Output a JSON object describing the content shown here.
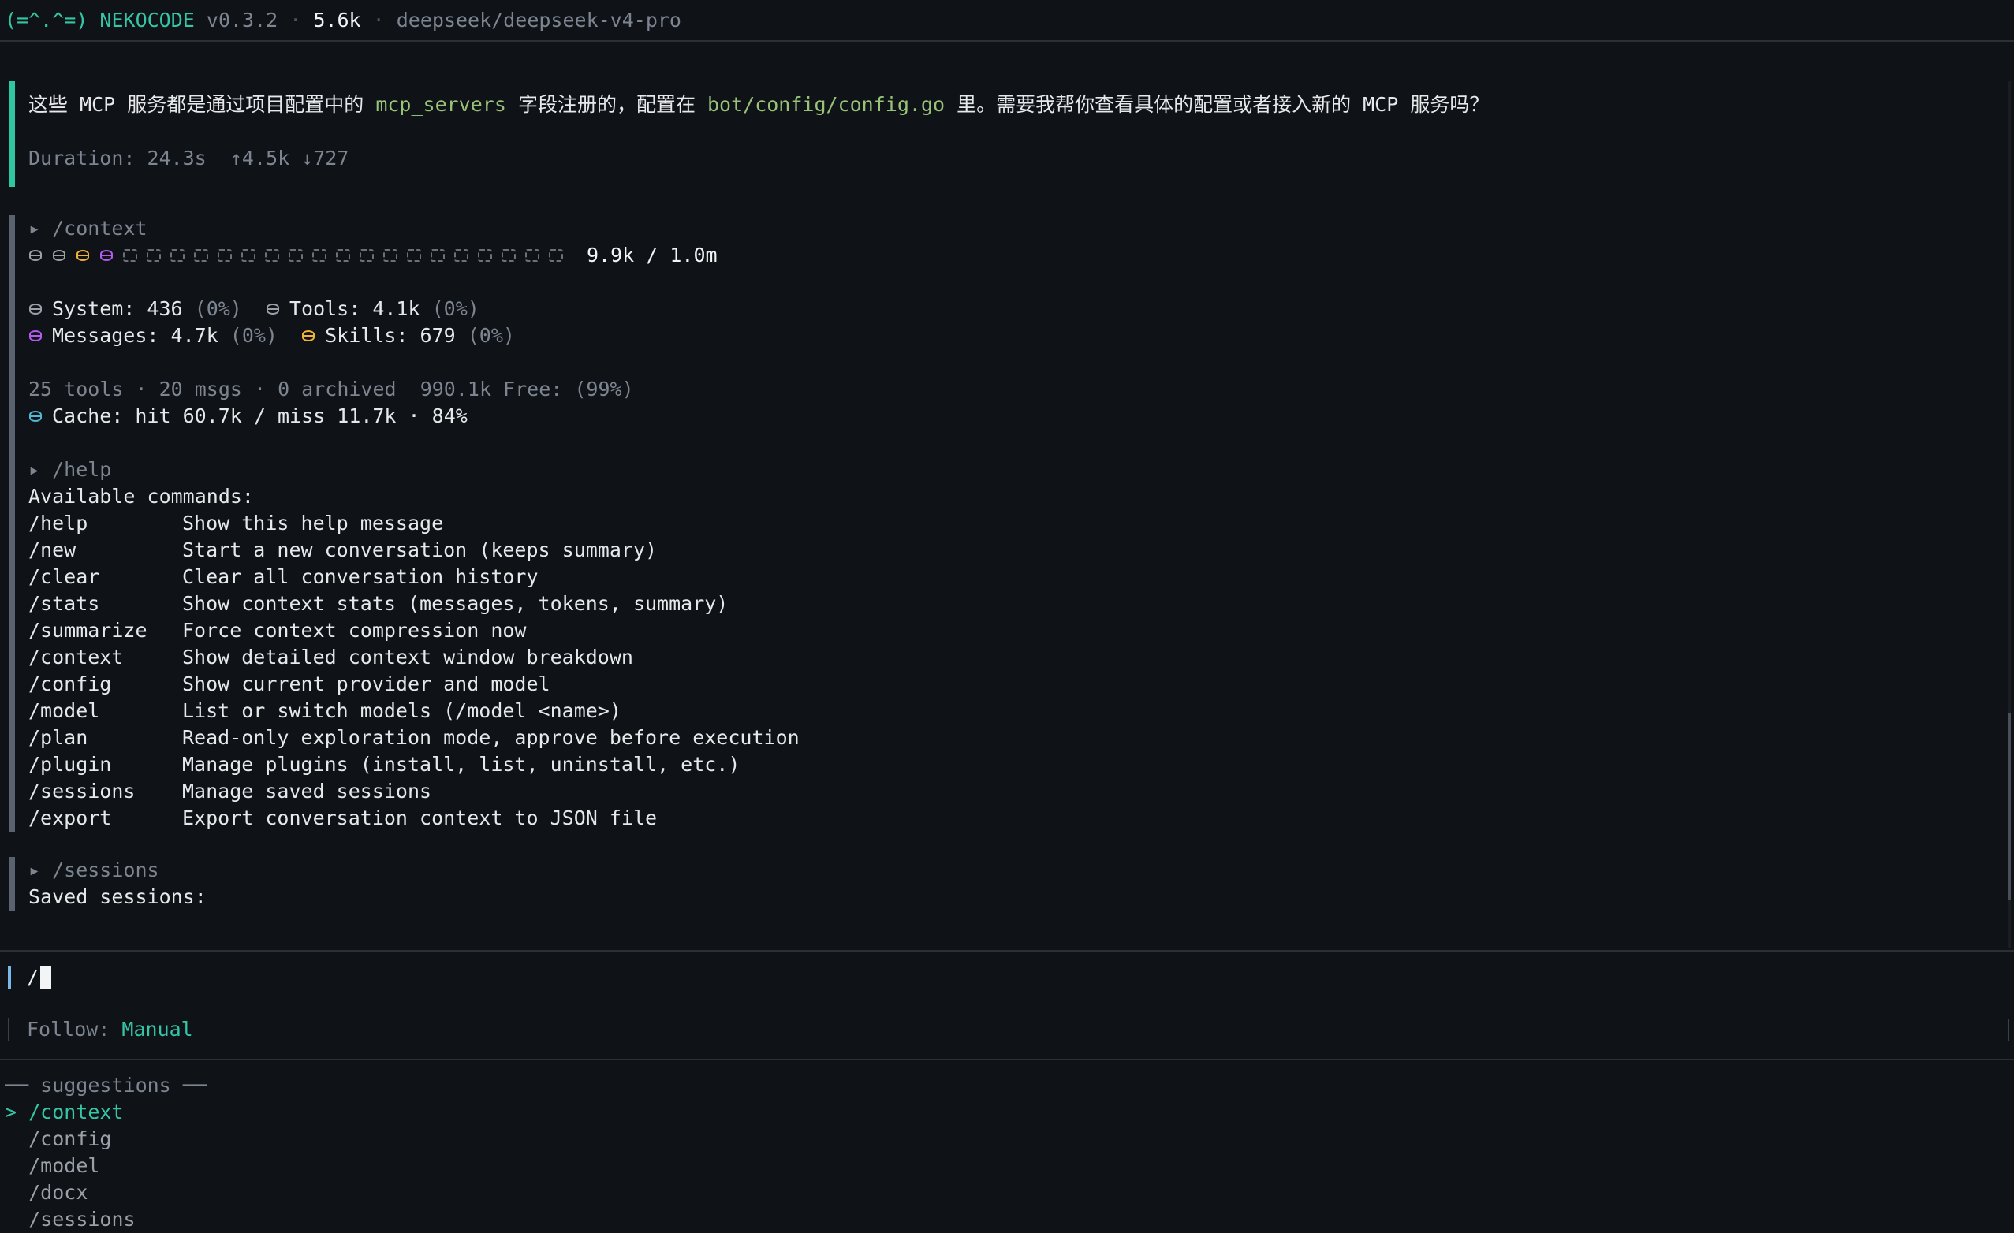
{
  "header": {
    "logo": "(=^.^=)",
    "app_name": "NEKOCODE",
    "version": "v0.3.2",
    "tokens": "5.6k",
    "model": "deepseek/deepseek-v4-pro"
  },
  "reply": {
    "text_part1": "这些 MCP 服务都是通过项目配置中的 ",
    "code1": "mcp_servers",
    "text_part2": " 字段注册的，配置在 ",
    "code2": "bot/config/config.go",
    "text_part3": " 里。需要我帮你查看具体的配置或者接入新的 MCP 服务吗？",
    "duration": "Duration: 24.3s  ↑4.5k ↓727"
  },
  "context": {
    "command": "▸ /context",
    "usage": "9.9k / 1.0m",
    "system_label": "System: 436",
    "system_pct": "(0%)",
    "tools_label": "Tools: 4.1k",
    "tools_pct": "(0%)",
    "messages_label": "Messages: 4.7k",
    "messages_pct": "(0%)",
    "skills_label": "Skills: 679",
    "skills_pct": "(0%)",
    "summary": "25 tools · 20 msgs · 0 archived  990.1k Free: (99%)",
    "cache": "Cache: hit 60.7k / miss 11.7k · 84%",
    "colors": {
      "system": "#9aa1a9",
      "tools": "#9aa1a9",
      "skills": "#f2b233",
      "messages": "#b45cf0",
      "cache": "#52b6d6",
      "accent": "#35c6a6"
    }
  },
  "help": {
    "command": "▸ /help",
    "title": "Available commands:",
    "rows": [
      {
        "cmd": "/help",
        "desc": "Show this help message"
      },
      {
        "cmd": "/new",
        "desc": "Start a new conversation (keeps summary)"
      },
      {
        "cmd": "/clear",
        "desc": "Clear all conversation history"
      },
      {
        "cmd": "/stats",
        "desc": "Show context stats (messages, tokens, summary)"
      },
      {
        "cmd": "/summarize",
        "desc": "Force context compression now"
      },
      {
        "cmd": "/context",
        "desc": "Show detailed context window breakdown"
      },
      {
        "cmd": "/config",
        "desc": "Show current provider and model"
      },
      {
        "cmd": "/model",
        "desc": "List or switch models (/model <name>)"
      },
      {
        "cmd": "/plan",
        "desc": "Read-only exploration mode, approve before execution"
      },
      {
        "cmd": "/plugin",
        "desc": "Manage plugins (install, list, uninstall, etc.)"
      },
      {
        "cmd": "/sessions",
        "desc": "Manage saved sessions"
      },
      {
        "cmd": "/export",
        "desc": "Export conversation context to JSON file"
      }
    ]
  },
  "sessions": {
    "command": "▸ /sessions",
    "title": "Saved sessions:"
  },
  "input": {
    "value": "/",
    "follow_label": "Follow: ",
    "follow_value": "Manual"
  },
  "suggestions": {
    "header": "── suggestions ──",
    "marker": "> ",
    "items": [
      "/context",
      "/config",
      "/model",
      "/docx",
      "/sessions"
    ]
  }
}
